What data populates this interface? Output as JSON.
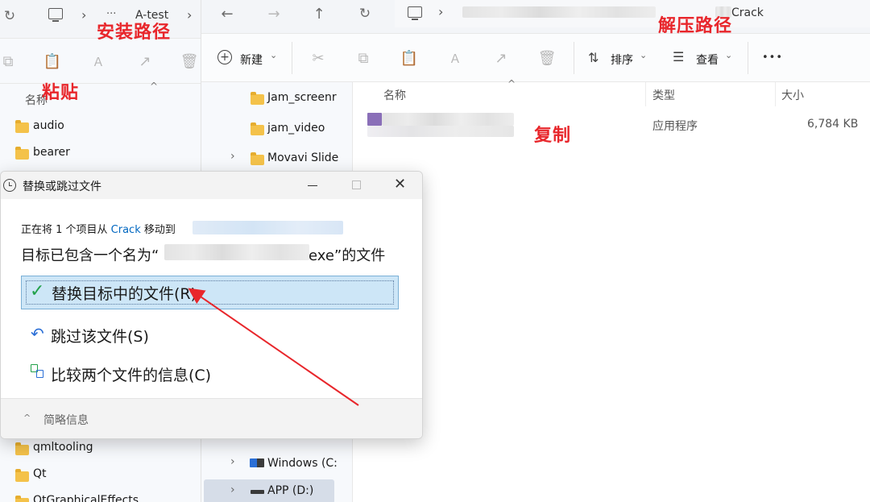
{
  "left_window": {
    "breadcrumb_more": "···",
    "breadcrumb_folder": "A-test",
    "column_name": "名称",
    "folders_top": [
      "audio",
      "bearer"
    ],
    "folders_bottom": [
      "qmltooling",
      "Qt",
      "QtGraphicalEffects"
    ]
  },
  "right_window": {
    "breadcrumb_folder": "Crack",
    "toolbar": {
      "new_label": "新建",
      "sort_label": "排序",
      "view_label": "查看",
      "more_label": "•••"
    },
    "nav_items": [
      "Jam_screenr",
      "jam_video",
      "Movavi Slide",
      "Windows (C:",
      "APP (D:)"
    ],
    "columns": {
      "name": "名称",
      "type": "类型",
      "size": "大小"
    },
    "file": {
      "type": "应用程序",
      "size": "6,784 KB"
    }
  },
  "annotations": {
    "install_path": "安装路径",
    "extract_path": "解压路径",
    "paste": "粘贴",
    "copy": "复制"
  },
  "dialog": {
    "title": "替换或跳过文件",
    "moving_prefix": "正在将 1 个项目从 ",
    "moving_source": "Crack",
    "moving_mid": " 移动到 ",
    "conflict_open": "目标已包含一个名为“",
    "conflict_close": "exe”的文件",
    "options": {
      "replace": "替换目标中的文件(R)",
      "skip": "跳过该文件(S)",
      "compare": "比较两个文件的信息(C)"
    },
    "details_label": "简略信息"
  },
  "colors": {
    "accent_red": "#e8262b",
    "link_blue": "#0067c0",
    "selection_bg": "#cde6f7",
    "check_green": "#22a14a"
  }
}
